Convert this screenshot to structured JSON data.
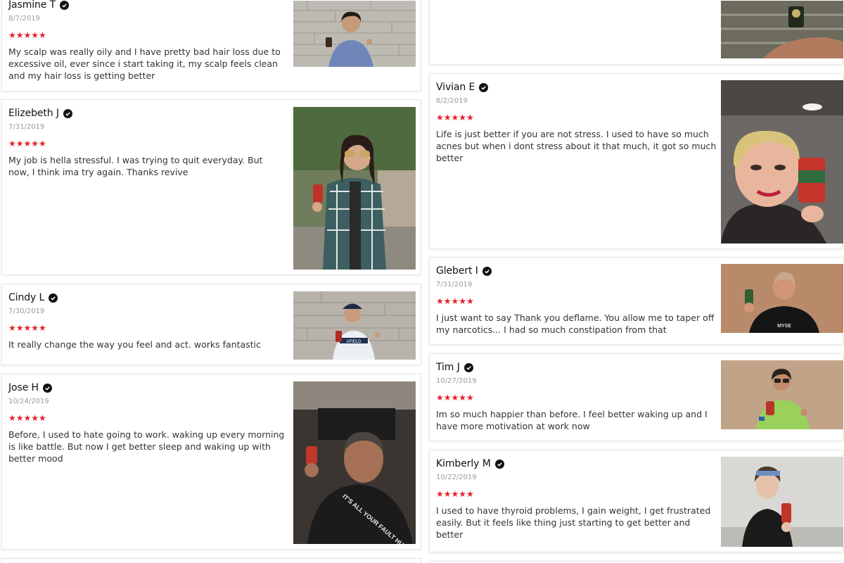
{
  "reviews": [
    {
      "name": "Jasmine T",
      "date": "8/7/2019",
      "stars": "★★★★★",
      "text": "My scalp was really oily and I have pretty bad hair loss due to excessive oil, ever since i start taking it,  my scalp feels clean and my hair loss is getting better"
    },
    {
      "name": "Elizebeth J",
      "date": "7/31/2019",
      "stars": "★★★★★",
      "text": "My job is hella stressful. I was trying to quit everyday. But now, I think ima try again. Thanks revive"
    },
    {
      "name": "Cindy L",
      "date": "7/30/2019",
      "stars": "★★★★★",
      "text": "It really change the way you feel and act. works fantastic"
    },
    {
      "name": "Jose H",
      "date": "10/24/2019",
      "stars": "★★★★★",
      "text": "Before, I used to hate going to work. waking up every morning is like battle. But now I get better sleep and waking up with better mood"
    },
    {
      "name": "Vivian E",
      "date": "8/2/2019",
      "stars": "★★★★★",
      "text": "Life is just better if you are not stress. I used to have so much acnes but when i dont stress about it that much, it got so much better"
    },
    {
      "name": "Glebert I",
      "date": "7/31/2019",
      "stars": "★★★★★",
      "text": "I just want to say Thank you deflame. You allow me to taper off my narcotics... I had so much constipation from that"
    },
    {
      "name": "Tim J",
      "date": "10/27/2019",
      "stars": "★★★★★",
      "text": "Im so much happier than before. I feel better waking up and I have more motivation at work now"
    },
    {
      "name": "Kimberly M",
      "date": "10/22/2019",
      "stars": "★★★★★",
      "text": "I used to have thyroid problems, I gain weight, I get frustrated easily. But it feels like thing just starting to get better and better"
    }
  ],
  "shirt_texts": {
    "jose": "IT'S ALL YOUR FAULT HUGH JACKMAN",
    "cindy": "AFIELD",
    "glebert": "MYSE"
  },
  "colors": {
    "star": "#e8202a",
    "verified": "#111111"
  }
}
